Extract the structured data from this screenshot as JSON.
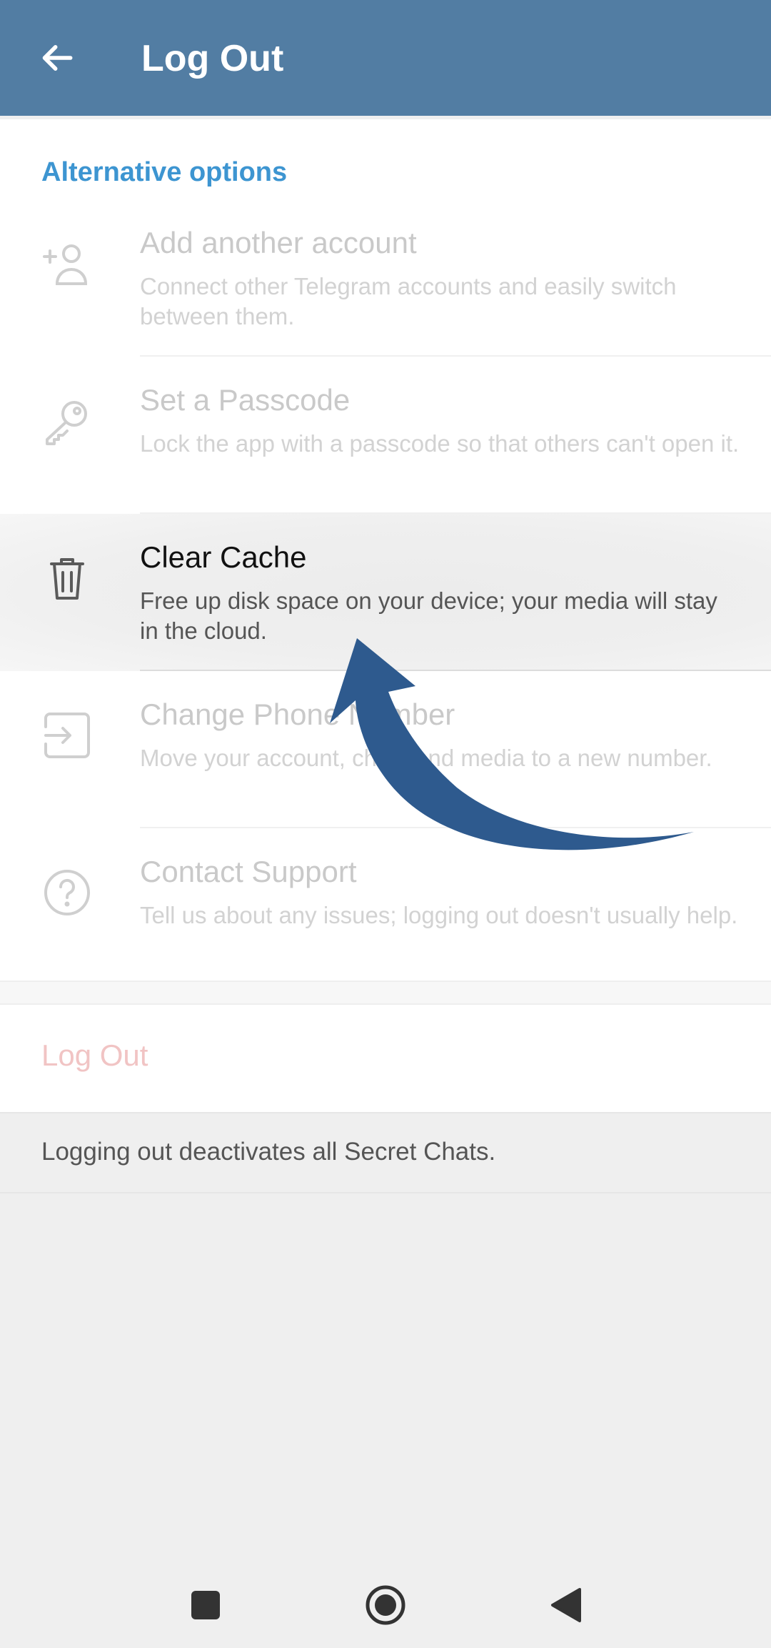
{
  "header": {
    "title": "Log Out"
  },
  "section": {
    "header": "Alternative options"
  },
  "options": [
    {
      "title": "Add another account",
      "subtitle": "Connect other Telegram accounts and easily switch between them.",
      "icon": "add-user-icon"
    },
    {
      "title": "Set a Passcode",
      "subtitle": "Lock the app with a passcode so that others can't open it.",
      "icon": "key-icon"
    },
    {
      "title": "Clear Cache",
      "subtitle": "Free up disk space on your device; your media will stay in the cloud.",
      "icon": "trash-icon"
    },
    {
      "title": "Change Phone Number",
      "subtitle": "Move your account, chats and media to a new number.",
      "icon": "change-number-icon"
    },
    {
      "title": "Contact Support",
      "subtitle": "Tell us about any issues; logging out doesn't usually help.",
      "icon": "help-icon"
    }
  ],
  "logout": {
    "label": "Log Out",
    "info": "Logging out deactivates all Secret Chats."
  },
  "colors": {
    "appbar": "#527da3",
    "accent": "#3d95d1",
    "annotation_arrow": "#2e5a8e",
    "logout": "#f1c4c4"
  },
  "navbar": {
    "icons": [
      "recents-square-icon",
      "home-circle-icon",
      "back-triangle-icon"
    ]
  }
}
